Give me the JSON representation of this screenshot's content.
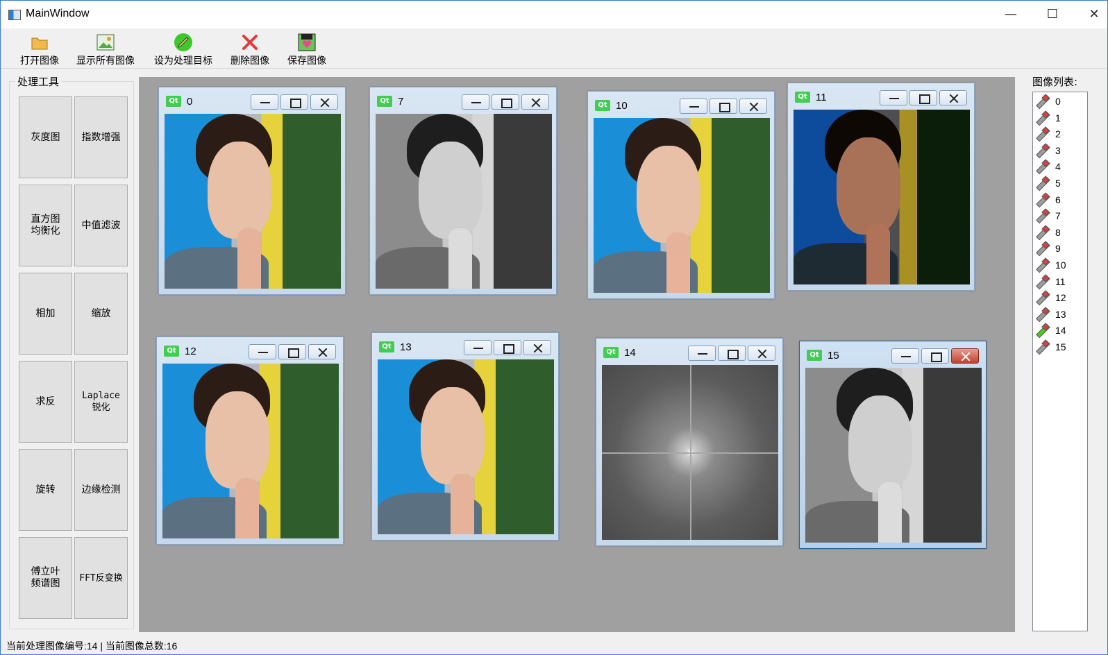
{
  "window": {
    "title": "MainWindow"
  },
  "toolbar": {
    "open": "打开图像",
    "show_all": "显示所有图像",
    "set_target": "设为处理目标",
    "delete": "删除图像",
    "save": "保存图像"
  },
  "tools": {
    "title": "处理工具",
    "buttons": [
      "灰度图",
      "指数增强",
      "直方图\n均衡化",
      "中值滤波",
      "相加",
      "缩放",
      "求反",
      "Laplace\n锐化",
      "旋转",
      "边缘检测",
      "傅立叶\n频谱图",
      "FFT反变换"
    ]
  },
  "subwindows": [
    {
      "title": "0",
      "kind": "color"
    },
    {
      "title": "7",
      "kind": "gray"
    },
    {
      "title": "10",
      "kind": "color"
    },
    {
      "title": "11",
      "kind": "dark"
    },
    {
      "title": "12",
      "kind": "color"
    },
    {
      "title": "13",
      "kind": "color"
    },
    {
      "title": "14",
      "kind": "fft"
    },
    {
      "title": "15",
      "kind": "gray",
      "active": true
    }
  ],
  "image_list": {
    "title": "图像列表:",
    "items": [
      "0",
      "1",
      "2",
      "3",
      "4",
      "5",
      "6",
      "7",
      "8",
      "9",
      "10",
      "11",
      "12",
      "13",
      "14",
      "15"
    ],
    "selected": "14"
  },
  "status": {
    "text": "当前处理图像编号:14 | 当前图像总数:16"
  },
  "colors": {
    "mdi_background": "#a0a0a0",
    "qt_badge": "#41cd52",
    "selected_icon": "#4ec81f"
  }
}
